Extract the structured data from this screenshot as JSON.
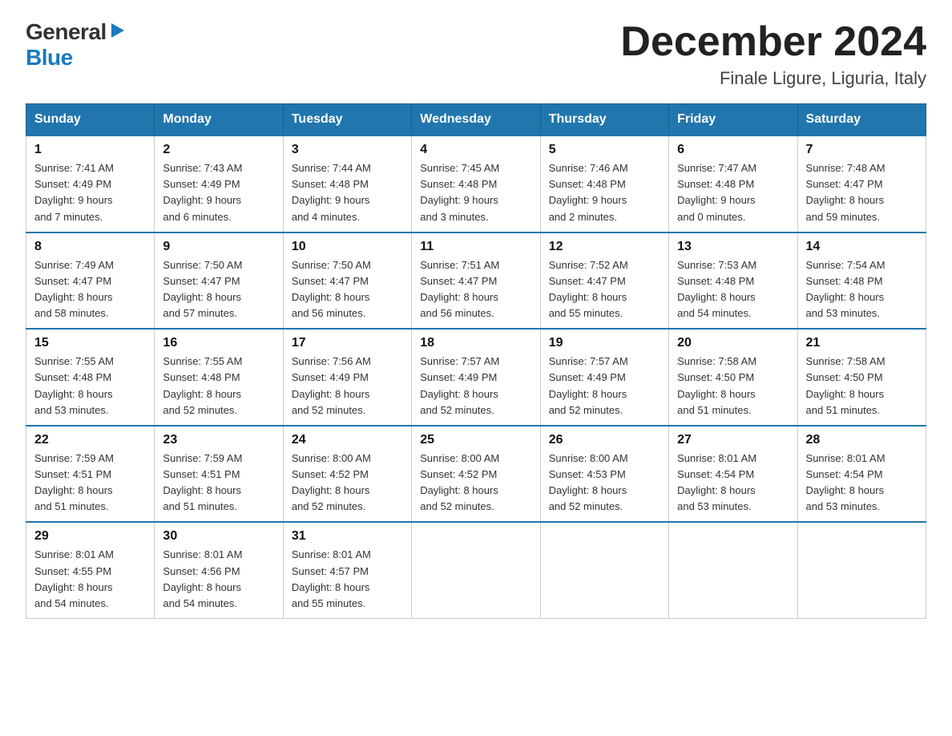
{
  "logo": {
    "general": "General",
    "blue": "Blue",
    "triangle_char": "▶"
  },
  "title": "December 2024",
  "subtitle": "Finale Ligure, Liguria, Italy",
  "headers": [
    "Sunday",
    "Monday",
    "Tuesday",
    "Wednesday",
    "Thursday",
    "Friday",
    "Saturday"
  ],
  "weeks": [
    [
      {
        "day": "1",
        "sunrise": "7:41 AM",
        "sunset": "4:49 PM",
        "daylight": "9 hours and 7 minutes."
      },
      {
        "day": "2",
        "sunrise": "7:43 AM",
        "sunset": "4:49 PM",
        "daylight": "9 hours and 6 minutes."
      },
      {
        "day": "3",
        "sunrise": "7:44 AM",
        "sunset": "4:48 PM",
        "daylight": "9 hours and 4 minutes."
      },
      {
        "day": "4",
        "sunrise": "7:45 AM",
        "sunset": "4:48 PM",
        "daylight": "9 hours and 3 minutes."
      },
      {
        "day": "5",
        "sunrise": "7:46 AM",
        "sunset": "4:48 PM",
        "daylight": "9 hours and 2 minutes."
      },
      {
        "day": "6",
        "sunrise": "7:47 AM",
        "sunset": "4:48 PM",
        "daylight": "9 hours and 0 minutes."
      },
      {
        "day": "7",
        "sunrise": "7:48 AM",
        "sunset": "4:47 PM",
        "daylight": "8 hours and 59 minutes."
      }
    ],
    [
      {
        "day": "8",
        "sunrise": "7:49 AM",
        "sunset": "4:47 PM",
        "daylight": "8 hours and 58 minutes."
      },
      {
        "day": "9",
        "sunrise": "7:50 AM",
        "sunset": "4:47 PM",
        "daylight": "8 hours and 57 minutes."
      },
      {
        "day": "10",
        "sunrise": "7:50 AM",
        "sunset": "4:47 PM",
        "daylight": "8 hours and 56 minutes."
      },
      {
        "day": "11",
        "sunrise": "7:51 AM",
        "sunset": "4:47 PM",
        "daylight": "8 hours and 56 minutes."
      },
      {
        "day": "12",
        "sunrise": "7:52 AM",
        "sunset": "4:47 PM",
        "daylight": "8 hours and 55 minutes."
      },
      {
        "day": "13",
        "sunrise": "7:53 AM",
        "sunset": "4:48 PM",
        "daylight": "8 hours and 54 minutes."
      },
      {
        "day": "14",
        "sunrise": "7:54 AM",
        "sunset": "4:48 PM",
        "daylight": "8 hours and 53 minutes."
      }
    ],
    [
      {
        "day": "15",
        "sunrise": "7:55 AM",
        "sunset": "4:48 PM",
        "daylight": "8 hours and 53 minutes."
      },
      {
        "day": "16",
        "sunrise": "7:55 AM",
        "sunset": "4:48 PM",
        "daylight": "8 hours and 52 minutes."
      },
      {
        "day": "17",
        "sunrise": "7:56 AM",
        "sunset": "4:49 PM",
        "daylight": "8 hours and 52 minutes."
      },
      {
        "day": "18",
        "sunrise": "7:57 AM",
        "sunset": "4:49 PM",
        "daylight": "8 hours and 52 minutes."
      },
      {
        "day": "19",
        "sunrise": "7:57 AM",
        "sunset": "4:49 PM",
        "daylight": "8 hours and 52 minutes."
      },
      {
        "day": "20",
        "sunrise": "7:58 AM",
        "sunset": "4:50 PM",
        "daylight": "8 hours and 51 minutes."
      },
      {
        "day": "21",
        "sunrise": "7:58 AM",
        "sunset": "4:50 PM",
        "daylight": "8 hours and 51 minutes."
      }
    ],
    [
      {
        "day": "22",
        "sunrise": "7:59 AM",
        "sunset": "4:51 PM",
        "daylight": "8 hours and 51 minutes."
      },
      {
        "day": "23",
        "sunrise": "7:59 AM",
        "sunset": "4:51 PM",
        "daylight": "8 hours and 51 minutes."
      },
      {
        "day": "24",
        "sunrise": "8:00 AM",
        "sunset": "4:52 PM",
        "daylight": "8 hours and 52 minutes."
      },
      {
        "day": "25",
        "sunrise": "8:00 AM",
        "sunset": "4:52 PM",
        "daylight": "8 hours and 52 minutes."
      },
      {
        "day": "26",
        "sunrise": "8:00 AM",
        "sunset": "4:53 PM",
        "daylight": "8 hours and 52 minutes."
      },
      {
        "day": "27",
        "sunrise": "8:01 AM",
        "sunset": "4:54 PM",
        "daylight": "8 hours and 53 minutes."
      },
      {
        "day": "28",
        "sunrise": "8:01 AM",
        "sunset": "4:54 PM",
        "daylight": "8 hours and 53 minutes."
      }
    ],
    [
      {
        "day": "29",
        "sunrise": "8:01 AM",
        "sunset": "4:55 PM",
        "daylight": "8 hours and 54 minutes."
      },
      {
        "day": "30",
        "sunrise": "8:01 AM",
        "sunset": "4:56 PM",
        "daylight": "8 hours and 54 minutes."
      },
      {
        "day": "31",
        "sunrise": "8:01 AM",
        "sunset": "4:57 PM",
        "daylight": "8 hours and 55 minutes."
      },
      null,
      null,
      null,
      null
    ]
  ]
}
